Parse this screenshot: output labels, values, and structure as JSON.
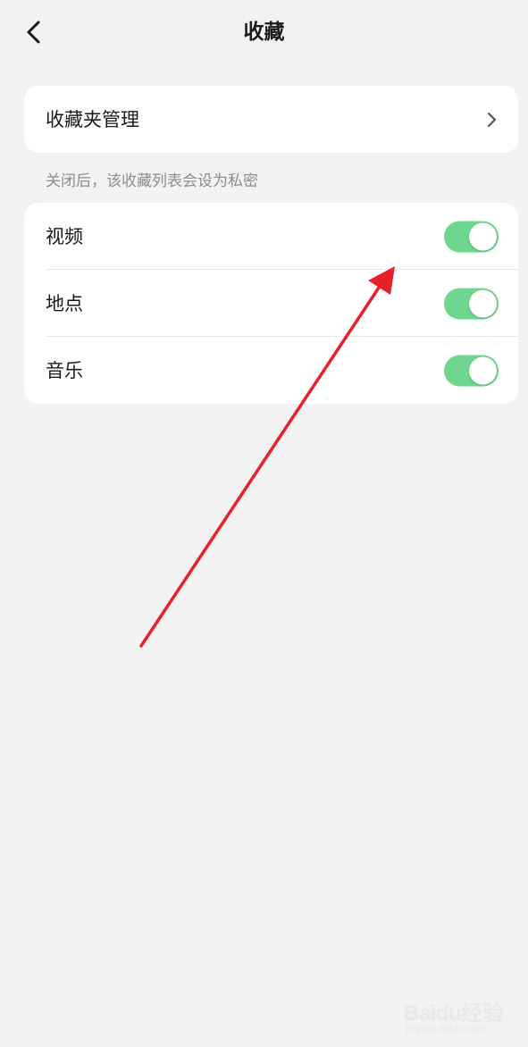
{
  "header": {
    "title": "收藏",
    "back_icon": "chevron-left-icon"
  },
  "manage_card": {
    "label": "收藏夹管理",
    "chevron_icon": "chevron-right-icon"
  },
  "privacy_hint": "关闭后，该收藏列表会设为私密",
  "toggles": [
    {
      "label": "视频",
      "enabled": true
    },
    {
      "label": "地点",
      "enabled": true
    },
    {
      "label": "音乐",
      "enabled": true
    }
  ],
  "colors": {
    "background": "#f2f2f2",
    "card": "#ffffff",
    "toggle_on": "#6fd68f",
    "hint_text": "#8c8c8c",
    "annotation_arrow": "#e8202a"
  },
  "watermark": {
    "brand": "Baidu经验",
    "sub": "jingyan.baidu.com"
  }
}
